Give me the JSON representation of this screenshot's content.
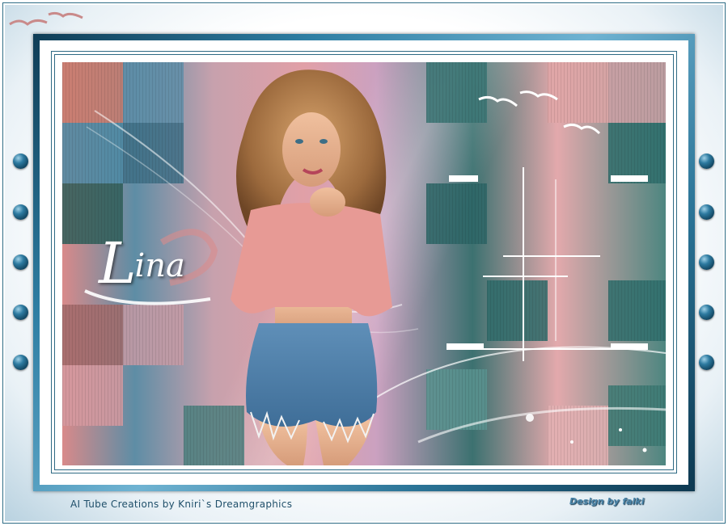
{
  "artwork": {
    "signature_name": "Lina",
    "signature_initial": "L",
    "signature_rest": "ina",
    "credit_left": "AI Tube Creations by Kniri`s Dreamgraphics",
    "credit_right": "Design by falki"
  },
  "decorations": {
    "side_dots_left_count": 5,
    "side_dots_right_count": 5,
    "frame_color": "#2e7ea3",
    "mat_color": "#ffffff",
    "bird_color": "#c98a8a"
  }
}
